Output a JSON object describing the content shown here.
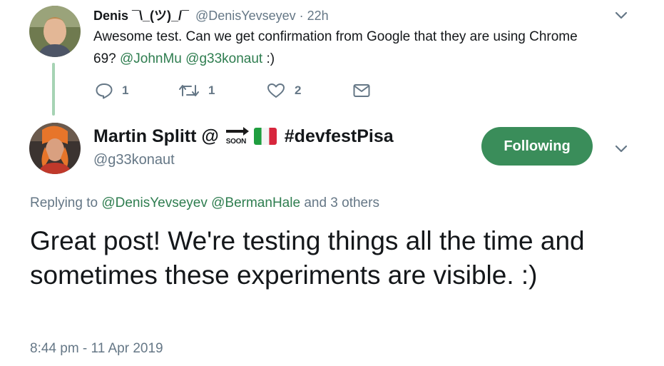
{
  "parent_tweet": {
    "display_name": "Denis ¯\\_(ツ)_/¯",
    "handle": "@DenisYevseyev",
    "separator": "·",
    "time": "22h",
    "text_line1": "Awesome test. Can we get confirmation from Google that they are using Chrome",
    "text_line2_prefix": "69? ",
    "mention1": "@JohnMu",
    "mention2": "@g33konaut",
    "text_suffix": " :)",
    "actions": {
      "replies": "1",
      "retweets": "1",
      "likes": "2"
    }
  },
  "main_tweet": {
    "display_name": "Martin Splitt @",
    "soon_label": "SOON",
    "hashtag": "#devfestPisa",
    "handle": "@g33konaut",
    "follow_label": "Following",
    "replying_prefix": "Replying to",
    "replying_user1": "@DenisYevseyev",
    "replying_user2": "@BermanHale",
    "replying_suffix": "and 3 others",
    "text": "Great post! We're testing things all the time and sometimes these experiments are visible. :)",
    "timestamp": "8:44 pm - 11 Apr 2019"
  },
  "colors": {
    "accent": "#3a8d5a",
    "link": "#2e7d4f",
    "thread_line": "#a6d3b4",
    "muted": "#657786"
  },
  "icons": [
    "chevron-down-icon",
    "reply-icon",
    "retweet-icon",
    "like-icon",
    "direct-message-icon",
    "soon-arrow-icon",
    "italy-flag-icon"
  ]
}
